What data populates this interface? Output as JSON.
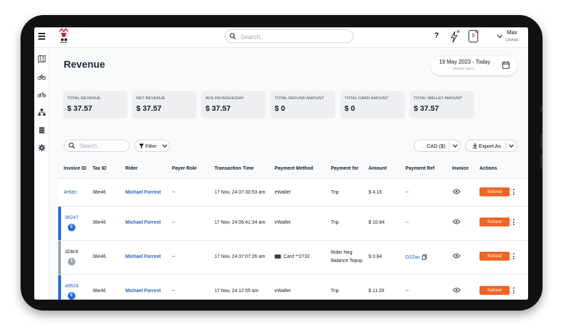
{
  "header": {
    "search_placeholder": "Search..",
    "help_label": "?",
    "notification_count": "0",
    "user_name": "Max",
    "user_role": "Owner"
  },
  "page": {
    "title": "Revenue",
    "date_range": "19 May 2023 - Today",
    "date_subtitle": "Lifetime report"
  },
  "summary_cards": [
    {
      "label": "TOTAL REVENUE",
      "value": "$ 37.57"
    },
    {
      "label": "NET REVENUE",
      "value": "$ 37.57"
    },
    {
      "label": "AVG REVENUE/DAY",
      "value": "$ 37.57"
    },
    {
      "label": "TOTAL REFUND AMOUNT",
      "value": "$ 0"
    },
    {
      "label": "TOTAL CARD AMOUNT",
      "value": "$ 0"
    },
    {
      "label": "TOTAL WALLET AMOUNT",
      "value": "$ 37.57"
    }
  ],
  "toolbar": {
    "search_placeholder": "Search..",
    "filter_label": "Filter",
    "currency_label": "CAD ($)",
    "export_label": "Export As"
  },
  "table": {
    "columns": [
      "Invoice ID",
      "Tax ID",
      "Rider",
      "Payer Role",
      "Transaction Time",
      "Payment Method",
      "Payment for",
      "Amount",
      "Payment Ref",
      "Invoice",
      "Actions"
    ],
    "rows": [
      {
        "invoice_id": "4e6dc",
        "badge": "",
        "tax_id": "38e46",
        "rider": "Michael Forrest",
        "payer_role": "--",
        "time": "17 Nov, 24 07:30:53 am",
        "method": "eWallet",
        "payment_for": "Trip",
        "payment_for_2": "",
        "amount": "$ 4.16",
        "ref": "--",
        "action": "Refund"
      },
      {
        "invoice_id": "96247",
        "badge": "E",
        "tax_id": "38e46",
        "rider": "Michael Forrest",
        "payer_role": "--",
        "time": "17 Nov, 24 06:41:34 am",
        "method": "eWallet",
        "payment_for": "Trip",
        "payment_for_2": "",
        "amount": "$ 10.84",
        "ref": "--",
        "action": "Refund"
      },
      {
        "invoice_id": "d28c9",
        "badge": "1",
        "tax_id": "38e46",
        "rider": "Michael Forrest",
        "payer_role": "--",
        "time": "17 Nov, 24 07:07:26 am",
        "method": "Card **2732",
        "payment_for": "Rider Neg",
        "payment_for_2": "Balance Topup",
        "amount": "$ 0.84",
        "ref": "D2Zao",
        "action": "Refund"
      },
      {
        "invoice_id": "a952d",
        "badge": "E",
        "tax_id": "38e46",
        "rider": "Michael Forrest",
        "payer_role": "--",
        "time": "17 Nov, 24 12:55 am",
        "method": "eWallet",
        "payment_for": "Trip",
        "payment_for_2": "",
        "amount": "$ 11.28",
        "ref": "--",
        "action": "Refund"
      }
    ]
  },
  "colors": {
    "accent_blue": "#1d5fc2",
    "refund_orange": "#f26522",
    "row_bar_blue": "#2563eb",
    "row_bar_gray": "#9ca3af"
  },
  "icons": {
    "nav": [
      "map-icon",
      "bicycle-icon",
      "motorbike-icon",
      "hierarchy-icon",
      "coins-icon",
      "settings-icon"
    ]
  }
}
